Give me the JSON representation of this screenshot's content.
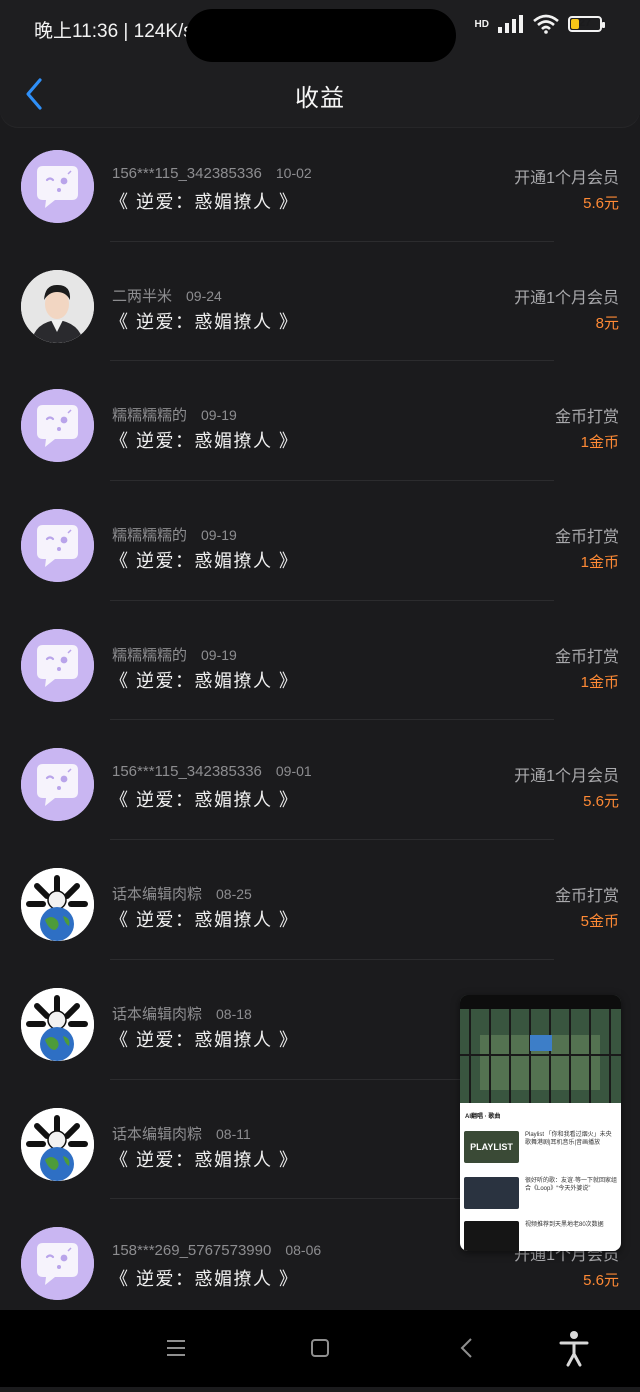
{
  "status_bar": {
    "time": "晚上11:36 | 124K/s",
    "network": "HD",
    "battery_level": "27"
  },
  "header": {
    "title": "收益"
  },
  "rows": [
    {
      "user": "156***115_342385336",
      "date": "10-02",
      "book": "《 逆爱：惑媚撩人 》",
      "reward_type": "开通1个月会员",
      "amount": "5.6元",
      "avatar": "default"
    },
    {
      "user": "二两半米",
      "date": "09-24",
      "book": "《 逆爱：惑媚撩人 》",
      "reward_type": "开通1个月会员",
      "amount": "8元",
      "avatar": "photo"
    },
    {
      "user": "糯糯糯糯的",
      "date": "09-19",
      "book": "《 逆爱：惑媚撩人 》",
      "reward_type": "金币打赏",
      "amount": "1金币",
      "avatar": "default"
    },
    {
      "user": "糯糯糯糯的",
      "date": "09-19",
      "book": "《 逆爱：惑媚撩人 》",
      "reward_type": "金币打赏",
      "amount": "1金币",
      "avatar": "default"
    },
    {
      "user": "糯糯糯糯的",
      "date": "09-19",
      "book": "《 逆爱：惑媚撩人 》",
      "reward_type": "金币打赏",
      "amount": "1金币",
      "avatar": "default"
    },
    {
      "user": "156***115_342385336",
      "date": "09-01",
      "book": "《 逆爱：惑媚撩人 》",
      "reward_type": "开通1个月会员",
      "amount": "5.6元",
      "avatar": "default"
    },
    {
      "user": "话本编辑肉粽",
      "date": "08-25",
      "book": "《 逆爱：惑媚撩人 》",
      "reward_type": "金币打赏",
      "amount": "5金币",
      "avatar": "globe"
    },
    {
      "user": "话本编辑肉粽",
      "date": "08-18",
      "book": "《 逆爱：惑媚撩人 》",
      "reward_type": "",
      "amount": "",
      "avatar": "globe"
    },
    {
      "user": "话本编辑肉粽",
      "date": "08-11",
      "book": "《 逆爱：惑媚撩人 》",
      "reward_type": "",
      "amount": "",
      "avatar": "globe"
    },
    {
      "user": "158***269_5767573990",
      "date": "08-06",
      "book": "《 逆爱：惑媚撩人 》",
      "reward_type": "开通1个月会员",
      "amount": "5.6元",
      "avatar": "default"
    }
  ],
  "floating_window": {
    "heading": "AI翻唱 · 歌曲",
    "items": [
      {
        "text": "Playlist 「你和我看过烟火」未央歌舞港剧|耳机音乐|音画播放",
        "thumb": "PLAYLIST"
      },
      {
        "text": "很好听的歌：友谊·等一下就回家组合《Loop》“今天外婆说”",
        "thumb": ""
      },
      {
        "text": "视频推荐到天黑地老80次数据",
        "thumb": ""
      }
    ]
  },
  "colors": {
    "accent_amount": "#ff8a35",
    "back_arrow": "#2f8ff7",
    "avatar_default": "#c9b6f2"
  }
}
